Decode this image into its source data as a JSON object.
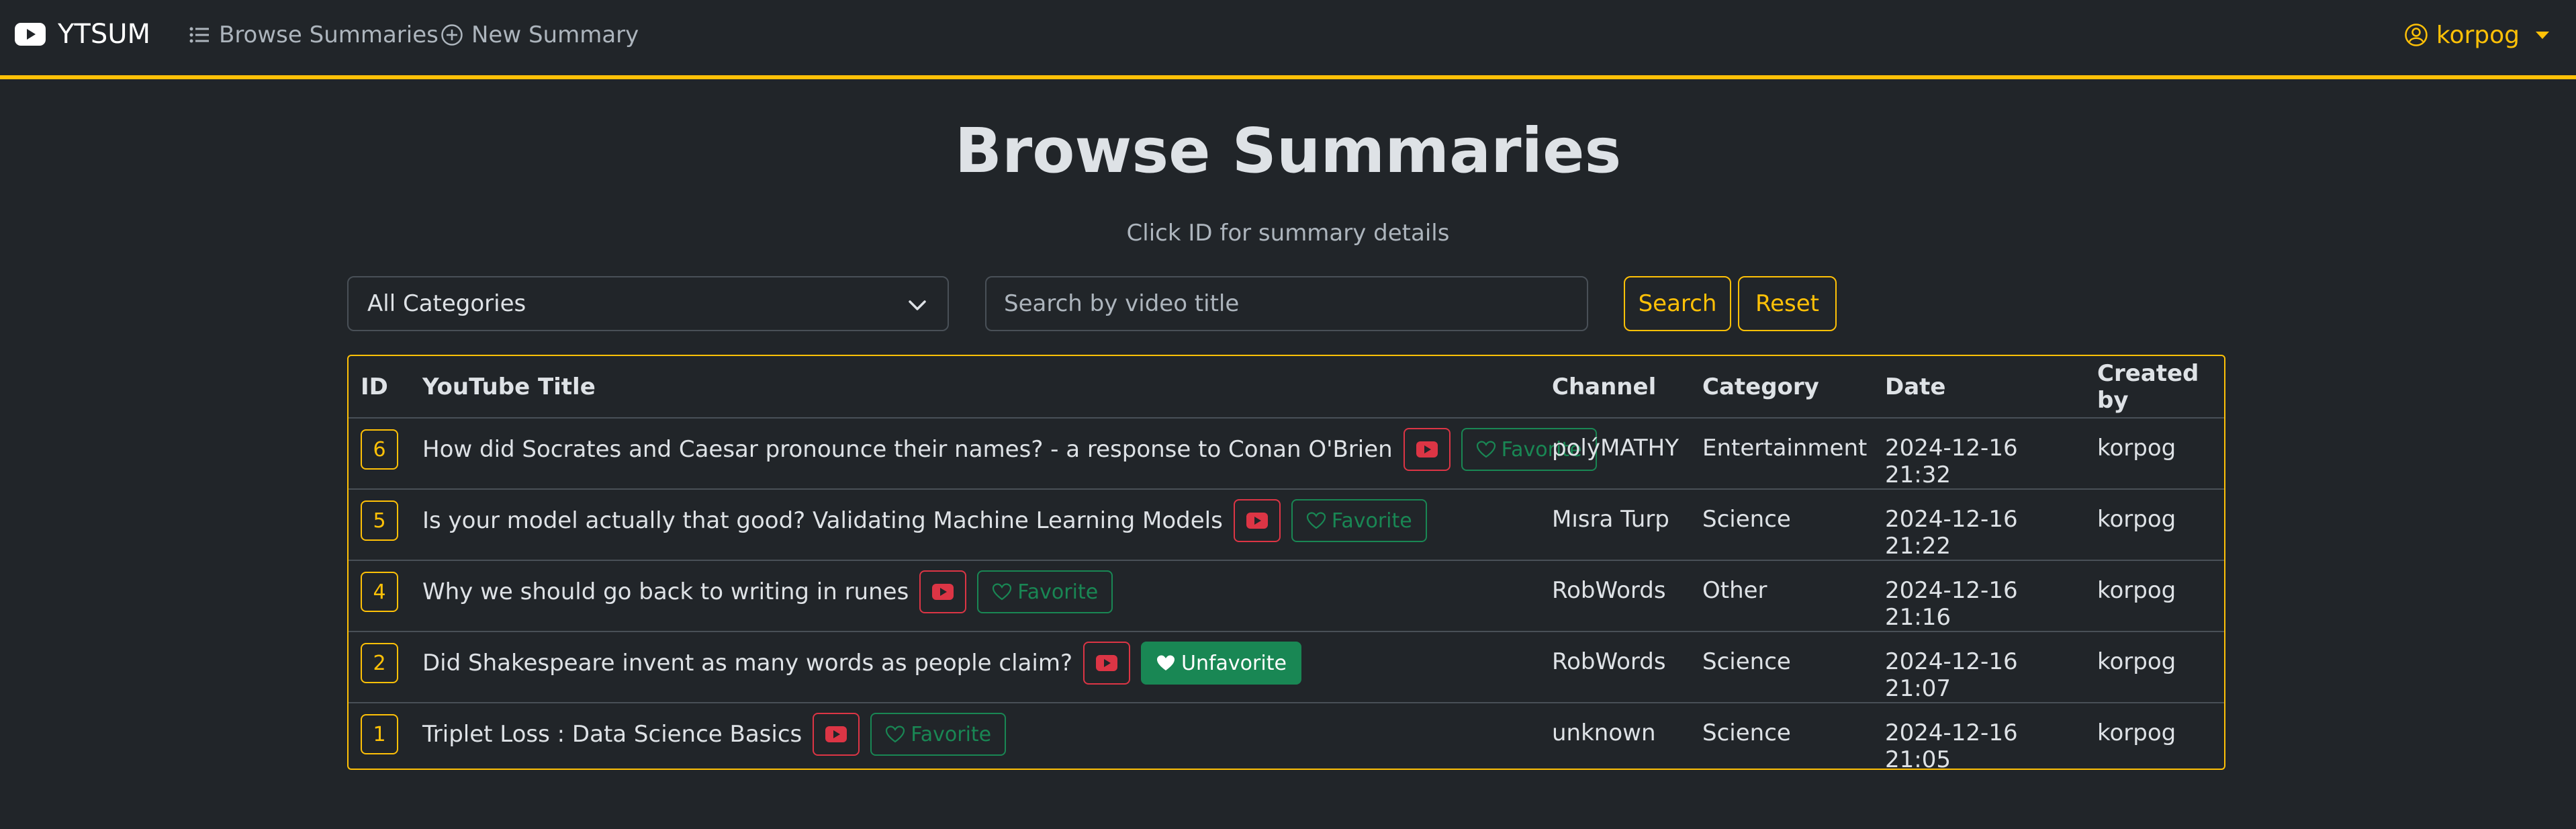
{
  "app": {
    "brand": "YTSUM",
    "nav": {
      "browse_label": "Browse Summaries",
      "new_label": "New Summary"
    },
    "user": "korpog"
  },
  "page": {
    "title": "Browse Summaries",
    "subtitle": "Click ID for summary details"
  },
  "filters": {
    "category_selected": "All Categories",
    "search_placeholder": "Search by video title",
    "search_value": "",
    "search_label": "Search",
    "reset_label": "Reset"
  },
  "table": {
    "headers": {
      "id": "ID",
      "title": "YouTube Title",
      "channel": "Channel",
      "category": "Category",
      "date": "Date",
      "created_by": "Created by"
    },
    "rows": [
      {
        "id": "6",
        "title": "How did Socrates and Caesar pronounce their names? - a response to Conan O'Brien",
        "favorite_label": "Favorite",
        "favorited": false,
        "channel": "polýMATHY",
        "category": "Entertainment",
        "date": "2024-12-16 21:32",
        "created_by": "korpog"
      },
      {
        "id": "5",
        "title": "Is your model actually that good? Validating Machine Learning Models",
        "favorite_label": "Favorite",
        "favorited": false,
        "channel": "Mısra Turp",
        "category": "Science",
        "date": "2024-12-16 21:22",
        "created_by": "korpog"
      },
      {
        "id": "4",
        "title": "Why we should go back to writing in runes",
        "favorite_label": "Favorite",
        "favorited": false,
        "channel": "RobWords",
        "category": "Other",
        "date": "2024-12-16 21:16",
        "created_by": "korpog"
      },
      {
        "id": "2",
        "title": "Did Shakespeare invent as many words as people claim?",
        "favorite_label": "Unfavorite",
        "favorited": true,
        "channel": "RobWords",
        "category": "Science",
        "date": "2024-12-16 21:07",
        "created_by": "korpog"
      },
      {
        "id": "1",
        "title": "Triplet Loss : Data Science Basics",
        "favorite_label": "Favorite",
        "favorited": false,
        "channel": "unknown",
        "category": "Science",
        "date": "2024-12-16 21:05",
        "created_by": "korpog"
      }
    ]
  },
  "colors": {
    "background": "#212529",
    "accent": "#ffc107",
    "youtube_red": "#dc3545",
    "favorite_green": "#198754",
    "text": "#dee2e6",
    "muted": "#adb5bd"
  },
  "icons": {
    "brand": "youtube-logo-icon",
    "browse": "list-icon",
    "new": "plus-circle-icon",
    "user": "person-circle-icon",
    "select": "chevron-down-icon",
    "watch": "youtube-play-icon",
    "favorite": "heart-outline-icon",
    "unfavorite": "heart-filled-icon"
  }
}
